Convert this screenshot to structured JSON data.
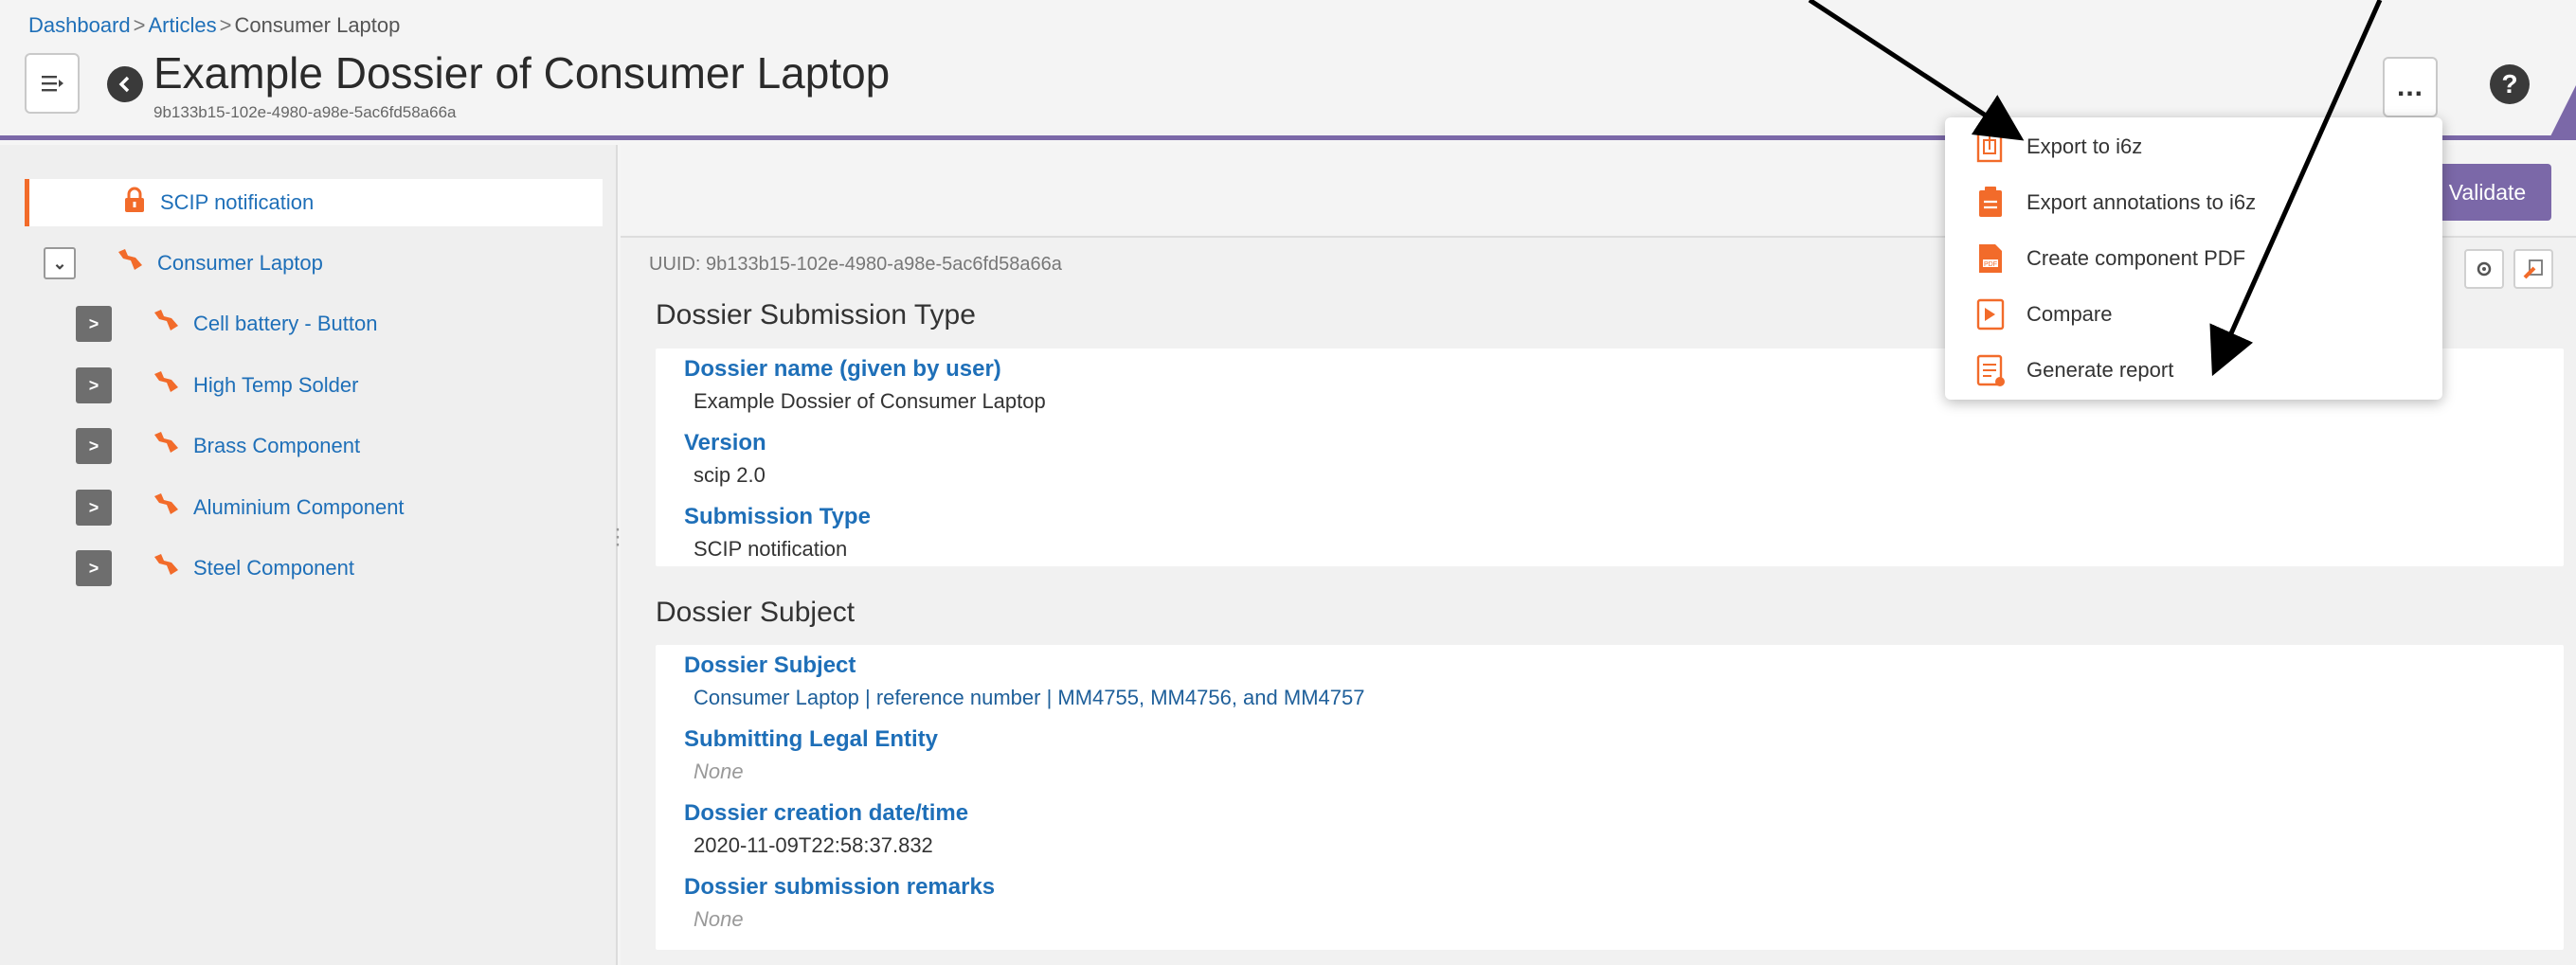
{
  "breadcrumb": {
    "items": [
      "Dashboard",
      "Articles",
      "Consumer Laptop"
    ],
    "separator": ">"
  },
  "header": {
    "title": "Example Dossier of Consumer Laptop",
    "uuid": "9b133b15-102e-4980-a98e-5ac6fd58a66a",
    "more_label": "...",
    "help_label": "?"
  },
  "sidebar": {
    "items": [
      {
        "label": "SCIP notification",
        "icon": "lock-icon"
      },
      {
        "label": "Consumer Laptop",
        "icon": "component-icon",
        "expanded": true
      },
      {
        "label": "Cell battery - Button",
        "icon": "component-icon"
      },
      {
        "label": "High Temp Solder",
        "icon": "component-icon"
      },
      {
        "label": "Brass Component",
        "icon": "component-icon"
      },
      {
        "label": "Aluminium Component",
        "icon": "component-icon"
      },
      {
        "label": "Steel Component",
        "icon": "component-icon"
      }
    ]
  },
  "main": {
    "validate_label": "Validate",
    "uuid_line": "UUID: 9b133b15-102e-4980-a98e-5ac6fd58a66a",
    "sections": [
      {
        "heading": "Dossier Submission Type",
        "fields": [
          {
            "label": "Dossier name (given by user)",
            "value": "Example Dossier of Consumer Laptop"
          },
          {
            "label": "Version",
            "value": "scip 2.0"
          },
          {
            "label": "Submission Type",
            "value": "SCIP notification"
          }
        ]
      },
      {
        "heading": "Dossier Subject",
        "fields": [
          {
            "label": "Dossier Subject",
            "value": "Consumer Laptop | reference number | MM4755, MM4756, and MM4757"
          },
          {
            "label": "Submitting Legal Entity",
            "value": "None"
          },
          {
            "label": "Dossier creation date/time",
            "value": "2020-11-09T22:58:37.832"
          },
          {
            "label": "Dossier submission remarks",
            "value": "None"
          }
        ]
      }
    ]
  },
  "dropdown": {
    "items": [
      {
        "label": "Export to i6z",
        "icon": "export-i6z-icon"
      },
      {
        "label": "Export annotations to i6z",
        "icon": "export-annotations-icon"
      },
      {
        "label": "Create component PDF",
        "icon": "pdf-icon"
      },
      {
        "label": "Compare",
        "icon": "compare-icon"
      },
      {
        "label": "Generate report",
        "icon": "report-icon"
      }
    ]
  },
  "colors": {
    "accent_purple": "#7b68a8",
    "link_blue": "#1e6fb8",
    "orange": "#f26b2a"
  }
}
